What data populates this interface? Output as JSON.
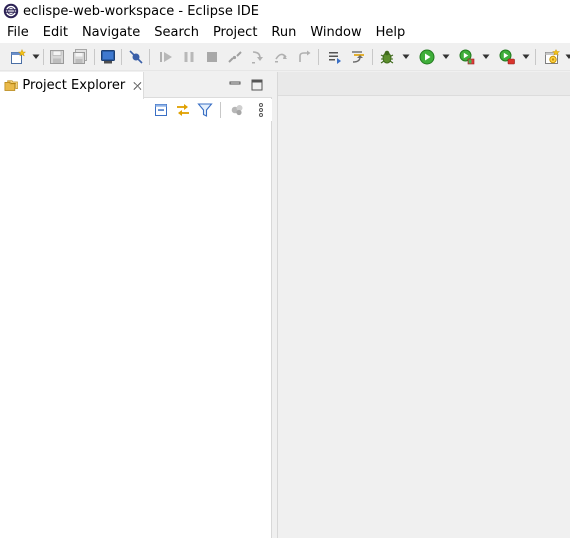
{
  "window": {
    "title": "eclispe-web-workspace - Eclipse IDE"
  },
  "menubar": {
    "items": [
      "File",
      "Edit",
      "Navigate",
      "Search",
      "Project",
      "Run",
      "Window",
      "Help"
    ]
  },
  "toolbar": {
    "icons": [
      "new-wizard-icon",
      "save-icon",
      "save-all-icon",
      "open-console-icon",
      "skip-breakpoints-icon",
      "resume-icon",
      "suspend-icon",
      "terminate-icon",
      "disconnect-icon",
      "step-into-icon",
      "step-over-icon",
      "step-return-icon",
      "use-step-filters-icon",
      "drop-to-frame-icon",
      "debug-icon",
      "run-icon",
      "coverage-icon",
      "external-tools-icon",
      "open-perspective-icon"
    ]
  },
  "project_explorer": {
    "tab_label": "Project Explorer",
    "view_tools": [
      "collapse-all-icon",
      "link-with-editor-icon",
      "filter-icon",
      "select-working-set-icon",
      "view-menu-icon"
    ]
  }
}
